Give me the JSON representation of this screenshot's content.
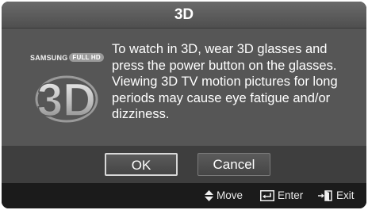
{
  "dialog": {
    "title": "3D",
    "brand": "SAMSUNG",
    "brand_badge": "FULL HD",
    "logo_text": "3D",
    "message": "To watch in 3D, wear 3D glasses and press the power button on the glasses. Viewing 3D TV motion pictures for long periods may cause eye fatigue and/or dizziness.",
    "buttons": {
      "ok": "OK",
      "cancel": "Cancel"
    }
  },
  "footer": {
    "move": {
      "icon": "updown-arrow-icon",
      "label": "Move"
    },
    "enter": {
      "icon": "enter-icon",
      "label": "Enter"
    },
    "exit": {
      "icon": "exit-icon",
      "label": "Exit"
    }
  },
  "colors": {
    "panel": "#565656",
    "title_bar": "#5e5e5e",
    "footer": "#1b1b1b",
    "text": "#ffffff"
  }
}
